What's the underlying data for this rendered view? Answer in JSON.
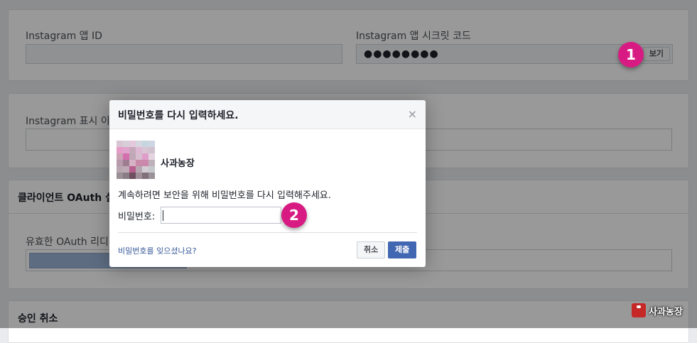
{
  "settings": {
    "app_id_label": "Instagram 앱 ID",
    "app_secret_label": "Instagram 앱 시크릿 코드",
    "app_secret_value": "●●●●●●●●",
    "view_button": "보기",
    "display_name_label": "Instagram 표시 이름",
    "oauth_section_title": "클라이언트 OAuth 설정",
    "redirect_uri_label": "유효한 OAuth 리디렉션 URI",
    "revoke_section_title": "승인 취소"
  },
  "dialog": {
    "title": "비밀번호를 다시 입력하세요.",
    "close_glyph": "×",
    "account_name": "사과농장",
    "message": "계속하려면 보안을 위해 비밀번호를 다시 입력해주세요.",
    "password_label": "비밀번호:",
    "password_value": "",
    "forgot_link": "비밀번호를 잊으셨나요?",
    "cancel_button": "취소",
    "submit_button": "제출"
  },
  "annotations": {
    "step1": "1",
    "step2": "2",
    "badge_color": "#d81b83"
  },
  "watermark": {
    "text": "사과농장",
    "logo_color": "#c62828"
  },
  "colors": {
    "primary_button": "#4267b2",
    "link": "#365899",
    "page_bg": "#e9ebee"
  },
  "avatar_pixels": [
    "#d9c6d3",
    "#d7cfd8",
    "#e3c9db",
    "#d6d7de",
    "#c5d6de",
    "#cfd4e2",
    "#e59dc8",
    "#e0a3cb",
    "#c5a9bb",
    "#ddb8d2",
    "#d8c5d4",
    "#cfc2ce",
    "#cba3b5",
    "#d46fae",
    "#bfa7b6",
    "#d7bdd0",
    "#de9ec9",
    "#e4d4e0",
    "#b99aac",
    "#9e7d90",
    "#d7b1c5",
    "#c98aa9",
    "#cc87ad",
    "#bfb1bc",
    "#b9a7b0",
    "#c0a9b7",
    "#b75f8e",
    "#b7a6b1",
    "#d1cdd3",
    "#c7c8cb",
    "#9b8f96",
    "#8a7c84",
    "#6e4f60",
    "#a08e98",
    "#807077",
    "#9a9399"
  ]
}
